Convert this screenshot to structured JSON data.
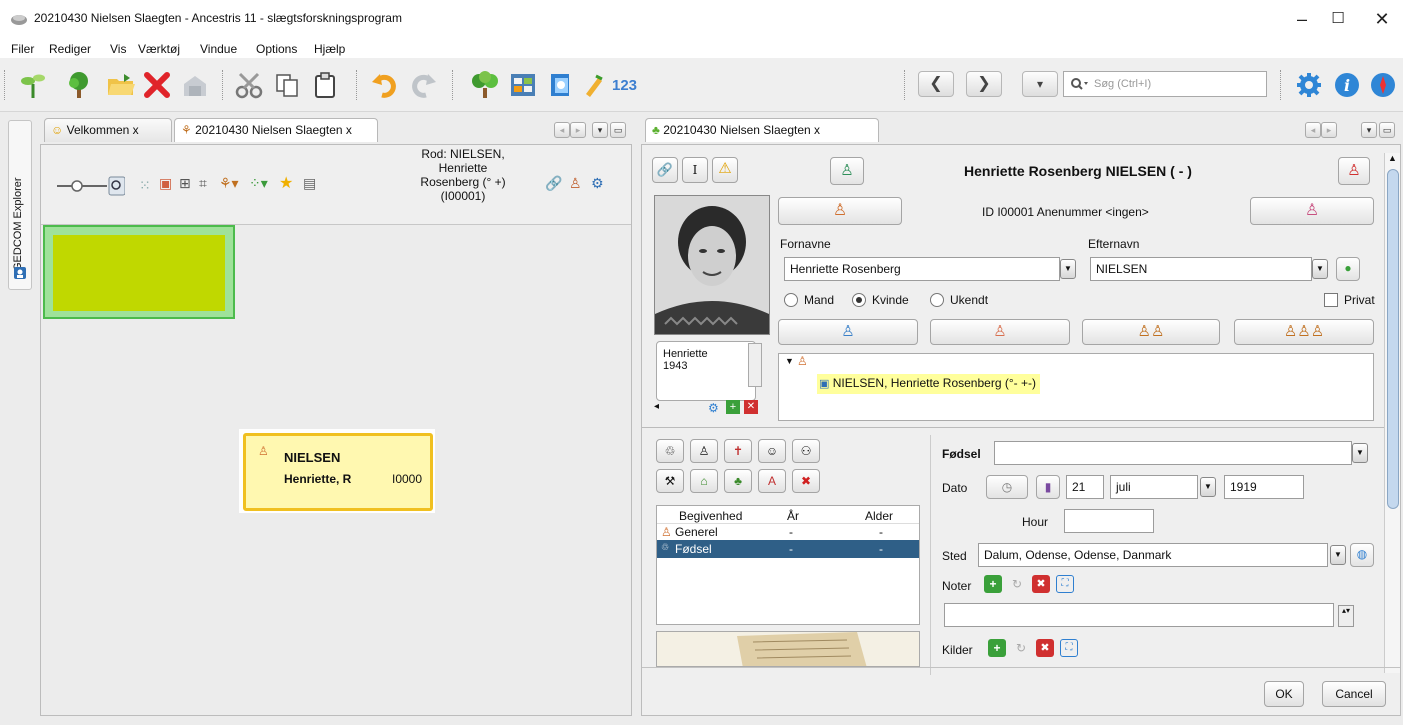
{
  "window": {
    "title": "20210430 Nielsen Slaegten - Ancestris 11 - slægtsforskningsprogram",
    "minimize": "–",
    "maximize": "☐",
    "close": "✕"
  },
  "menu": [
    "Filer",
    "Rediger",
    "Vis",
    "Værktøj",
    "Vindue",
    "Options",
    "Hjælp"
  ],
  "toolbar": {
    "numbers_label": "123",
    "search_placeholder": "Søg (Ctrl+I)",
    "back": "❮",
    "forward": "❯",
    "history": "▾"
  },
  "sidebar": {
    "explorer_label": "GEDCOM Explorer"
  },
  "left_panel": {
    "tabs": [
      {
        "label": "Velkommen",
        "close": "x"
      },
      {
        "label": "20210430 Nielsen Slaegten",
        "close": "x"
      }
    ],
    "root_info": [
      "Rod: NIELSEN,",
      "Henriette",
      "Rosenberg (° +)",
      "(I00001)"
    ],
    "tree_card": {
      "surname": "NIELSEN",
      "given": "Henriette, R",
      "id": "I0000"
    }
  },
  "right_panel": {
    "tab": {
      "label": "20210430 Nielsen Slaegten",
      "close": "x"
    },
    "header_name": "Henriette Rosenberg NIELSEN ( - )",
    "id_line": "ID I00001  Anenummer <ingen>",
    "fornavne_label": "Fornavne",
    "fornavne_value": "Henriette Rosenberg",
    "efternavn_label": "Efternavn",
    "efternavn_value": "NIELSEN",
    "sex": {
      "mand": "Mand",
      "kvinde": "Kvinde",
      "ukendt": "Ukendt",
      "selected": "Kvinde"
    },
    "privat_label": "Privat",
    "photo_caption": [
      "Henriette",
      "1943"
    ],
    "family_tree_item": "NIELSEN, Henriette Rosenberg (°- +-)",
    "events": {
      "columns": [
        "Begivenhed",
        "År",
        "Alder"
      ],
      "rows": [
        {
          "name": "Generel",
          "year": "-",
          "age": "-"
        },
        {
          "name": "Fødsel",
          "year": "-",
          "age": "-"
        }
      ],
      "selected_index": 1
    },
    "event_detail": {
      "type_label": "Fødsel",
      "dato_label": "Dato",
      "day": "21",
      "month": "juli",
      "year": "1919",
      "hour_label": "Hour",
      "hour_value": "",
      "sted_label": "Sted",
      "sted_value": "Dalum, Odense, Odense, Danmark",
      "noter_label": "Noter",
      "kilder_label": "Kilder"
    },
    "ok_label": "OK",
    "cancel_label": "Cancel"
  },
  "colors": {
    "tree_box_fill": "#c0d800",
    "tree_box_border": "#4cbb4c",
    "card_border": "#f0c020",
    "card_fill": "#fff8b0",
    "selected_row": "#2f5f87",
    "highlight": "#ffff9c"
  }
}
